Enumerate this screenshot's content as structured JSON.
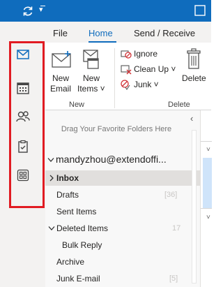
{
  "titlebar": {
    "sync_icon": "sync-icon",
    "customize_icon": "chevron-down-icon"
  },
  "nav": {
    "items": [
      {
        "icon": "mail-icon"
      },
      {
        "icon": "calendar-icon"
      },
      {
        "icon": "people-icon"
      },
      {
        "icon": "tasks-icon"
      },
      {
        "icon": "apps-icon"
      }
    ],
    "highlight_color": "#e11b22"
  },
  "ribbon": {
    "tabs": [
      {
        "label": "File"
      },
      {
        "label": "Home"
      },
      {
        "label": "Send / Receive"
      }
    ],
    "new_email": {
      "line1": "New",
      "line2": "Email"
    },
    "new_items": {
      "line1": "New",
      "line2": "Items ˅"
    },
    "new_group_label": "New",
    "ignore": "Ignore",
    "clean_up": "Clean Up ˅",
    "junk": "Junk ˅",
    "delete_label": "Delete",
    "delete_group_label": "Delete"
  },
  "folders": {
    "favorites_hint": "Drag Your Favorite Folders Here",
    "account": "mandyzhou@extendoffi...",
    "items": [
      {
        "label": "Inbox",
        "count": ""
      },
      {
        "label": "Drafts",
        "count": "[36]"
      },
      {
        "label": "Sent Items",
        "count": ""
      },
      {
        "label": "Deleted Items",
        "count": "17"
      },
      {
        "label": "Bulk Reply",
        "count": ""
      },
      {
        "label": "Archive",
        "count": ""
      },
      {
        "label": "Junk E-mail",
        "count": "[5]"
      }
    ]
  },
  "colors": {
    "accent": "#0f6cbd",
    "titlebar": "#0f6cbd"
  }
}
